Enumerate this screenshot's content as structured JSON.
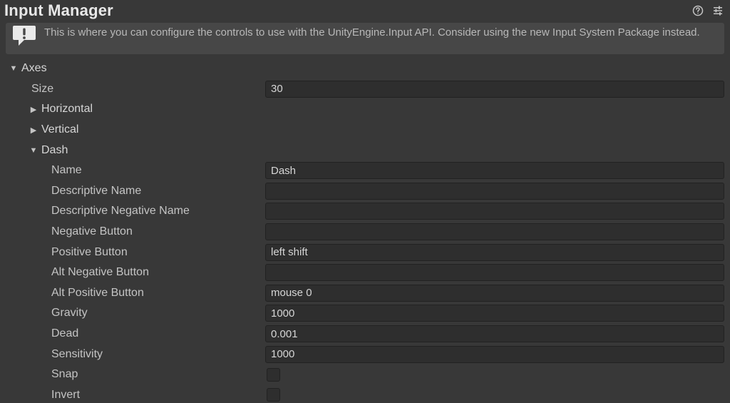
{
  "header": {
    "title": "Input Manager"
  },
  "info": {
    "text": "This is where you can configure the controls to use with the UnityEngine.Input API. Consider using the new Input System Package instead."
  },
  "axes": {
    "label": "Axes",
    "size_label": "Size",
    "size_value": "30",
    "items": {
      "horizontal": "Horizontal",
      "vertical": "Vertical",
      "dash": "Dash"
    }
  },
  "dash": {
    "name_label": "Name",
    "name_value": "Dash",
    "descriptive_name_label": "Descriptive Name",
    "descriptive_name_value": "",
    "descriptive_negative_name_label": "Descriptive Negative Name",
    "descriptive_negative_name_value": "",
    "negative_button_label": "Negative Button",
    "negative_button_value": "",
    "positive_button_label": "Positive Button",
    "positive_button_value": "left shift",
    "alt_negative_button_label": "Alt Negative Button",
    "alt_negative_button_value": "",
    "alt_positive_button_label": "Alt Positive Button",
    "alt_positive_button_value": "mouse 0",
    "gravity_label": "Gravity",
    "gravity_value": "1000",
    "dead_label": "Dead",
    "dead_value": "0.001",
    "sensitivity_label": "Sensitivity",
    "sensitivity_value": "1000",
    "snap_label": "Snap",
    "snap_value": false,
    "invert_label": "Invert",
    "invert_value": false
  }
}
